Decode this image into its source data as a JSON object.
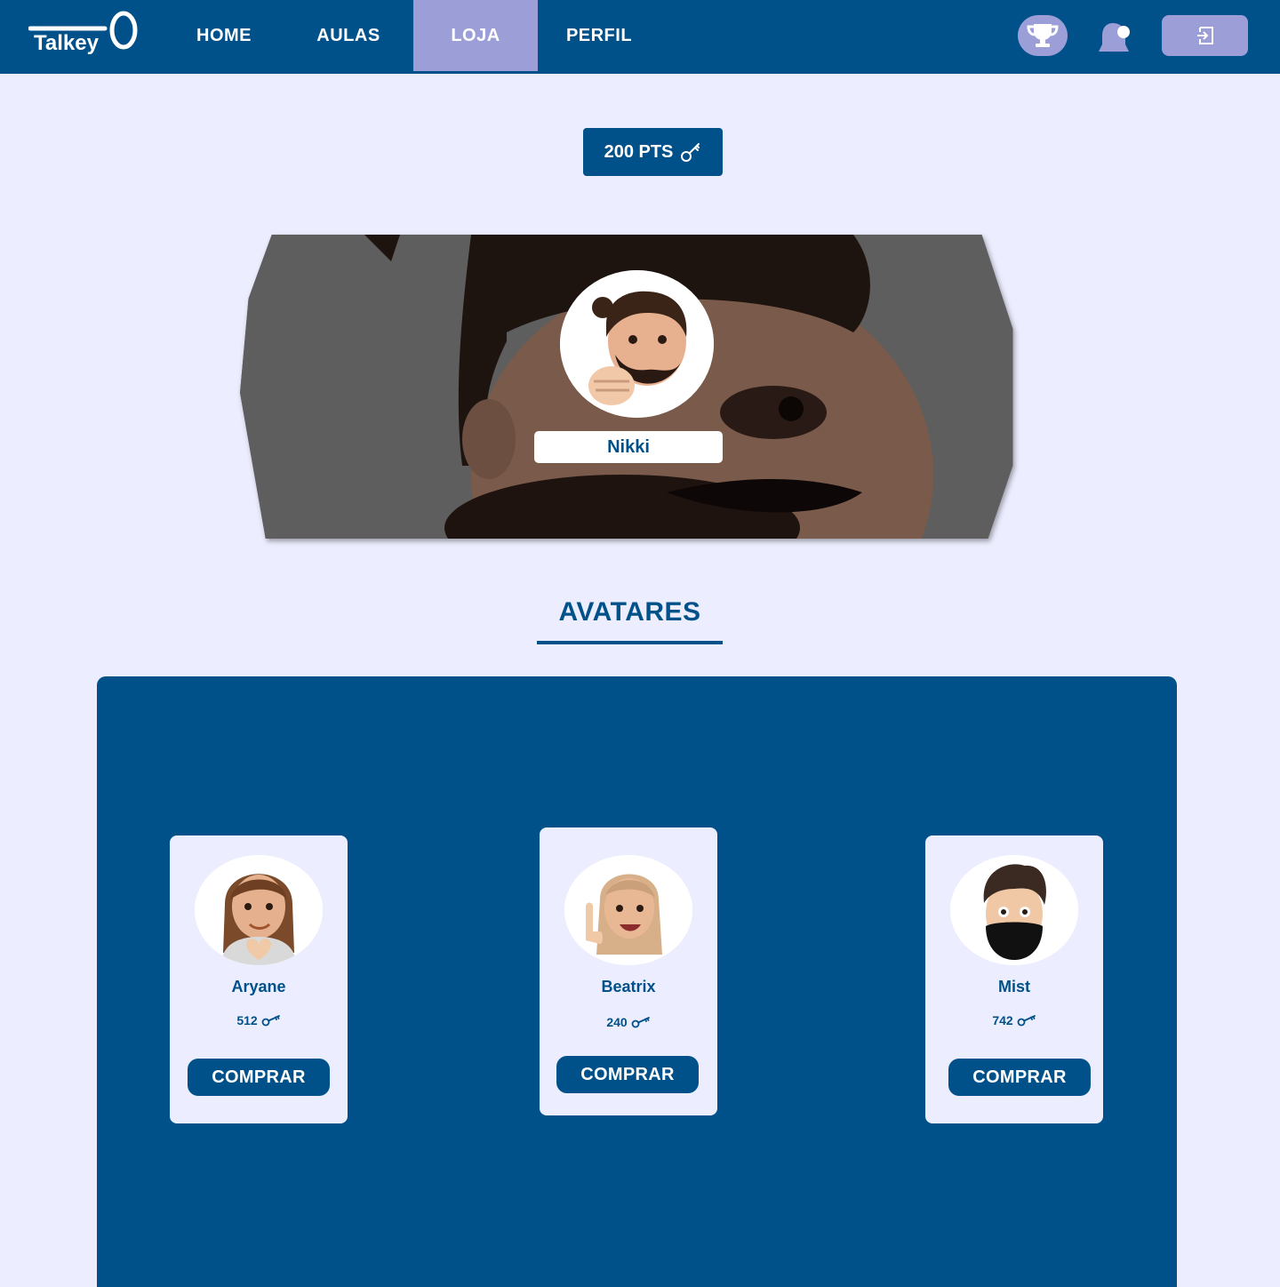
{
  "brand": {
    "logo_text": "Talkey"
  },
  "nav": {
    "items": [
      {
        "label": "HOME",
        "active": false
      },
      {
        "label": "AULAS",
        "active": false
      },
      {
        "label": "LOJA",
        "active": true
      },
      {
        "label": "PERFIL",
        "active": false
      }
    ],
    "icons": {
      "trophy": "trophy-icon",
      "notifications": "bell-icon",
      "logout": "logout-icon"
    }
  },
  "points": {
    "label": "200 PTS",
    "icon": "key-icon"
  },
  "profile": {
    "name": "Nikki"
  },
  "section": {
    "title": "AVATARES"
  },
  "avatars": [
    {
      "name": "Aryane",
      "price": "512",
      "button": "COMPRAR"
    },
    {
      "name": "Beatrix",
      "price": "240",
      "button": "COMPRAR"
    },
    {
      "name": "Mist",
      "price": "742",
      "button": "COMPRAR"
    }
  ],
  "colors": {
    "primary": "#005189",
    "accent": "#9c9ed7",
    "background": "#ecedfe",
    "white": "#ffffff"
  }
}
